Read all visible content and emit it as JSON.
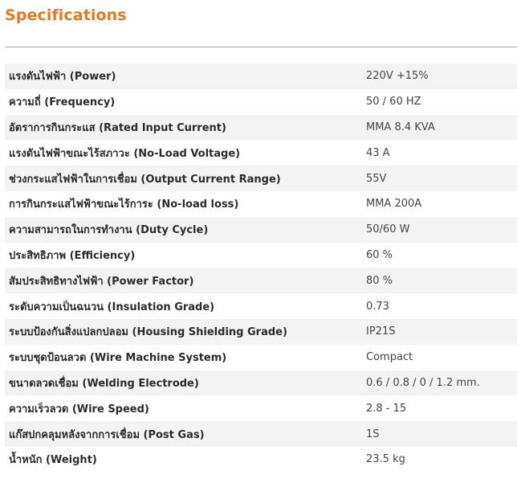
{
  "heading": "Specifications",
  "colors": {
    "heading": "#e87722",
    "row_stripe": "#f3f3f3",
    "divider": "#a8a8a8"
  },
  "specs": [
    {
      "label": "แรงดันไฟฟ้า (Power)",
      "value": "220V +15%"
    },
    {
      "label": "ความถี่ (Frequency)",
      "value": "50 / 60 HZ"
    },
    {
      "label": "อัตราการกินกระแส (Rated Input Current)",
      "value": "MMA 8.4 KVA"
    },
    {
      "label": "แรงดันไฟฟ้าขณะไร้สภาวะ (No-Load Voltage)",
      "value": "43 A"
    },
    {
      "label": "ช่วงกระแสไฟฟ้าในการเชื่อม (Output Current Range)",
      "value": "55V"
    },
    {
      "label": "การกินกระแสไฟฟ้าขณะไร้การะ (No-load loss)",
      "value": "MMA 200A"
    },
    {
      "label": "ความสามารถในการทำงาน (Duty Cycle)",
      "value": "50/60 W"
    },
    {
      "label": "ประสิทธิภาพ (Efficiency)",
      "value": "60 %"
    },
    {
      "label": "สัมประสิทธิทางไฟฟ้า (Power Factor)",
      "value": "80 %"
    },
    {
      "label": "ระดับความเป็นฉนวน (Insulation Grade)",
      "value": "0.73"
    },
    {
      "label": "ระบบป้องกันสิ่งแปลกปลอม (Housing Shielding Grade)",
      "value": "IP21S"
    },
    {
      "label": "ระบบชุดป้อนลวด (Wire Machine System)",
      "value": "Compact"
    },
    {
      "label": "ขนาดลวดเชื่อม (Welding Electrode)",
      "value": "0.6 / 0.8 / 0 / 1.2 mm."
    },
    {
      "label": "ความเร็วลวด (Wire Speed)",
      "value": "2.8 - 15"
    },
    {
      "label": "แก๊สปกคลุมหลังจากการเชื่อม (Post Gas)",
      "value": "1S"
    },
    {
      "label": "น้ำหนัก (Weight)",
      "value": "23.5 kg"
    }
  ]
}
